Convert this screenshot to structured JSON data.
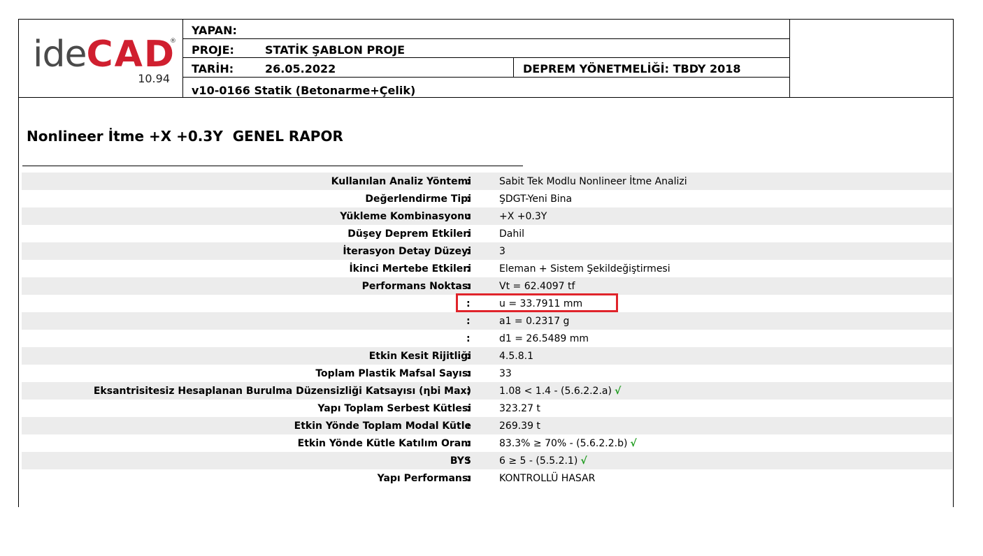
{
  "header": {
    "logo_ide": "ide",
    "logo_cad": "CAD",
    "logo_reg": "®",
    "logo_version": "10.94",
    "yapan_label": "YAPAN:",
    "yapan_value": "",
    "proje_label": "PROJE:",
    "proje_value": "STATİK ŞABLON PROJE",
    "tarih_label": "TARİH:",
    "tarih_value": "26.05.2022",
    "deprem": "DEPREM YÖNETMELİĞİ: TBDY 2018",
    "program_version": "v10-0166 Statik (Betonarme+Çelik)"
  },
  "report": {
    "title": "Nonlineer İtme +X +0.3Y  GENEL RAPOR",
    "colon": ":",
    "rows": [
      {
        "label": "Kullanılan Analiz Yöntemi",
        "value": "Sabit Tek Modlu Nonlineer İtme Analizi"
      },
      {
        "label": "Değerlendirme Tipi",
        "value": "ŞDGT-Yeni Bina"
      },
      {
        "label": "Yükleme Kombinasyonu",
        "value": "+X +0.3Y"
      },
      {
        "label": "Düşey Deprem Etkileri",
        "value": "Dahil"
      },
      {
        "label": "İterasyon Detay Düzeyi",
        "value": "3"
      },
      {
        "label": "İkinci Mertebe Etkileri",
        "value": "Eleman + Sistem Şekildeğiştirmesi"
      },
      {
        "label": "Performans Noktası",
        "value": "Vt = 62.4097 tf"
      },
      {
        "label": "",
        "value": "u = 33.7911 mm"
      },
      {
        "label": "",
        "value": "a1 = 0.2317 g"
      },
      {
        "label": "",
        "value": "d1 = 26.5489 mm"
      },
      {
        "label": "Etkin Kesit Rijitliği",
        "value": "4.5.8.1"
      },
      {
        "label": "Toplam Plastik Mafsal Sayısı",
        "value": "33"
      },
      {
        "label": "Eksantrisitesiz Hesaplanan Burulma Düzensizliği Katsayısı (ηbi Max)",
        "value": "1.08 < 1.4  -  (5.6.2.2.a)",
        "check": "√"
      },
      {
        "label": "Yapı Toplam Serbest Kütlesi",
        "value": "323.27 t"
      },
      {
        "label": "Etkin Yönde Toplam Modal Kütle",
        "value": "269.39 t"
      },
      {
        "label": "Etkin Yönde Kütle Katılım Oranı",
        "value": "83.3% ≥ 70%  -  (5.6.2.2.b)",
        "check": "√"
      },
      {
        "label": "BYS",
        "value": "6 ≥ 5  -  (5.5.2.1)",
        "check": "√"
      },
      {
        "label": "Yapı Performansı",
        "value": "KONTROLLÜ HASAR"
      }
    ]
  },
  "colors": {
    "logo_red": "#d01f2f",
    "row_shade": "#ececec",
    "highlight": "#e0242b",
    "check_green": "#1a9a1a"
  }
}
